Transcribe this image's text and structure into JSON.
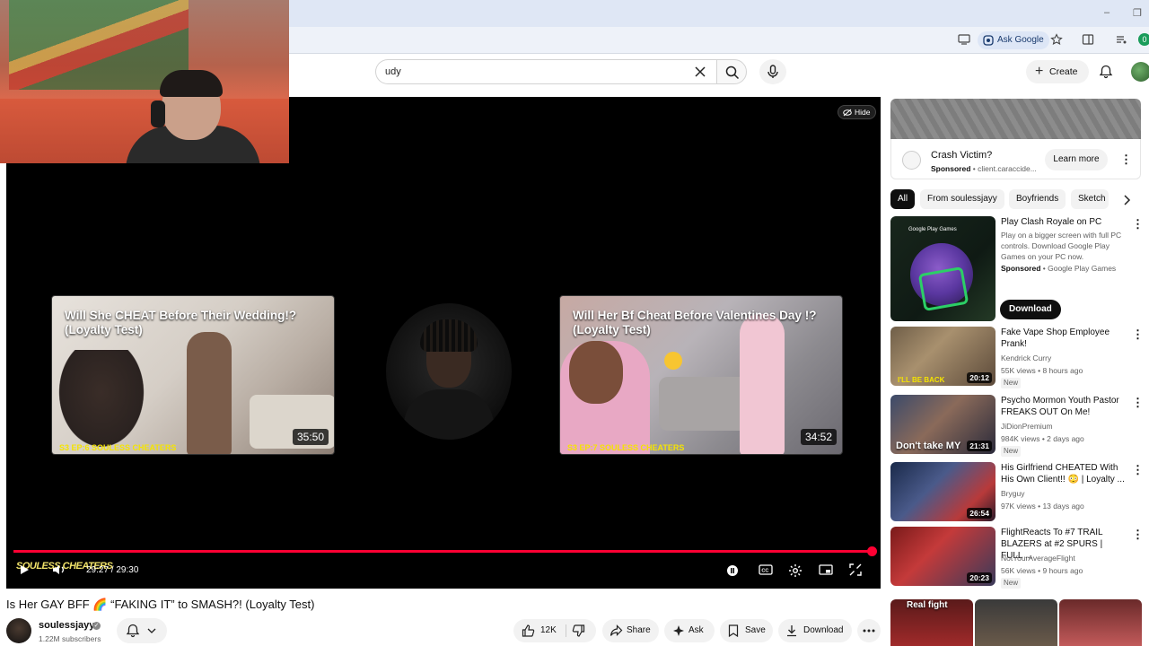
{
  "browser": {
    "ask_google_label": "Ask Google",
    "profile_initial": "0",
    "window_controls": [
      "–",
      "❐"
    ]
  },
  "header": {
    "search_value": "udy",
    "create_label": "Create"
  },
  "player": {
    "hide_label": "Hide",
    "endcards": [
      {
        "title": "Will She CHEAT Before Their Wedding!? (Loyalty Test)",
        "duration": "35:50",
        "badge": "S3 EP:6 SOULESS CHEATERS"
      },
      {
        "title": "Will Her Bf Cheat Before Valentines Day !? (Loyalty Test)",
        "duration": "34:52",
        "badge": "S3 EP:7 SOULESS CHEATERS"
      }
    ],
    "time_display": "29:27 / 29:30",
    "progress_fraction": 0.998,
    "overlay_logo": "SOULESS CHEATERS"
  },
  "video": {
    "title": "Is Her GAY BFF 🌈 “FAKING IT” to SMASH?! (Loyalty Test)",
    "channel_name": "soulessjayy",
    "subscribers": "1.22M subscribers",
    "like_count": "12K",
    "share_label": "Share",
    "ask_label": "Ask",
    "save_label": "Save",
    "download_label": "Download"
  },
  "sidebar": {
    "ad": {
      "title": "Crash Victim?",
      "sponsored": "Sponsored",
      "domain": "client.caraccide...",
      "cta": "Learn more"
    },
    "chips": [
      "All",
      "From soulessjayy",
      "Boyfriends",
      "Sketch"
    ],
    "sponsored_item": {
      "title": "Play Clash Royale on PC",
      "description": "Play on a bigger screen with full PC controls. Download Google Play Games on your PC now.",
      "sponsor_label": "Sponsored",
      "sponsor": " • Google Play Games",
      "thumb_label": "Google Play Games",
      "cta": "Download"
    },
    "items": [
      {
        "title": "Fake Vape Shop Employee Prank!",
        "channel": "Kendrick Curry",
        "meta": "55K views • 8 hours ago",
        "duration": "20:12",
        "badge": "New",
        "thumb_text": "I'LL BE BACK"
      },
      {
        "title": "Psycho Mormon Youth Pastor FREAKS OUT On Me!",
        "channel": "JiDionPremium",
        "meta": "984K views • 2 days ago",
        "duration": "21:31",
        "badge": "New",
        "thumb_text": "Don't take MY"
      },
      {
        "title": "His Girlfriend CHEATED With His Own Client!! 😳 | Loyalty ...",
        "channel": "Bryguy",
        "meta": "97K views • 13 days ago",
        "duration": "26:54",
        "badge": "",
        "thumb_text": ""
      },
      {
        "title": "FlightReacts To #7 TRAIL BLAZERS at #2 SPURS | FULL ...",
        "channel": "NotYourAverageFlight",
        "meta": "56K views • 9 hours ago",
        "duration": "20:23",
        "badge": "New",
        "thumb_text": ""
      }
    ],
    "shorts_first_label": "Real fight"
  },
  "colors": {
    "progress": "#ff0033",
    "endcard_badge": "#f5e400"
  }
}
